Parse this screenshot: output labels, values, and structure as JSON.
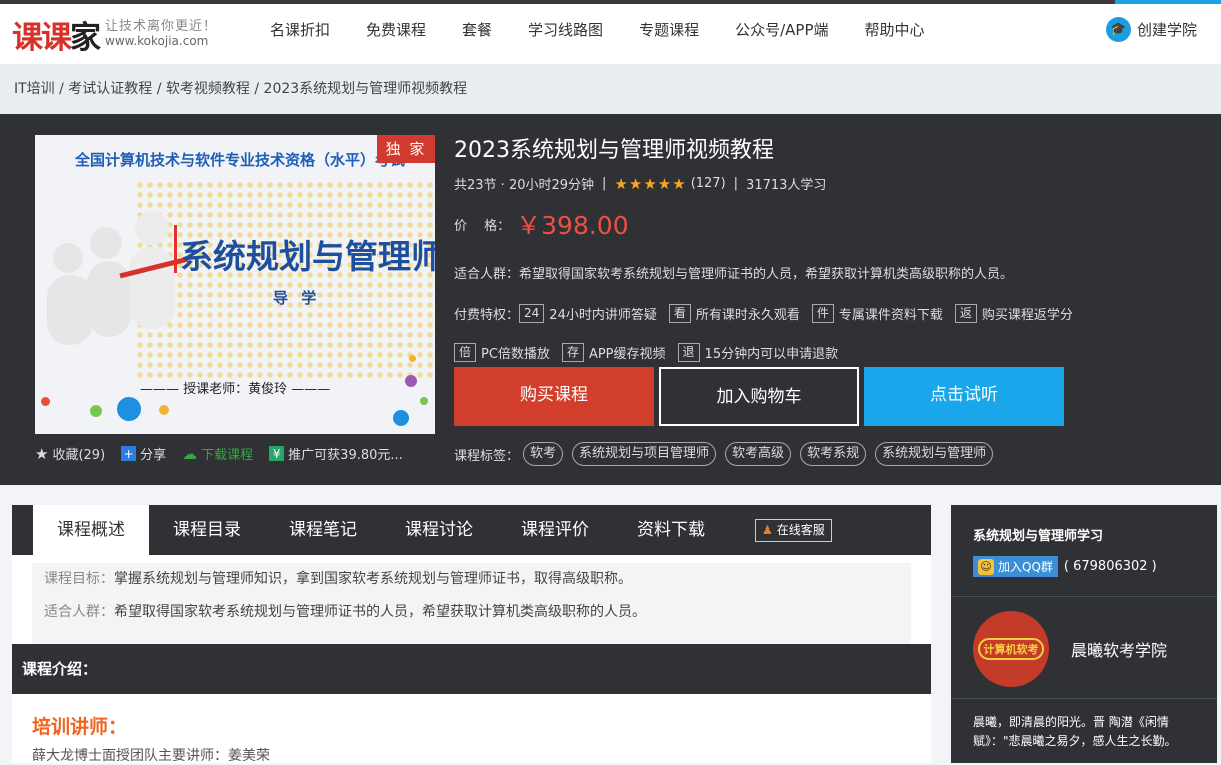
{
  "colors": {
    "brand_red": "#d8302a",
    "accent_blue": "#1aa3e8",
    "buy": "#d23e2c",
    "try": "#1aa6ea",
    "price": "#ef4f3f",
    "dark": "#2f3135",
    "lecturer": "#f0641e"
  },
  "logo": {
    "text_red": "课课",
    "text_black": "家",
    "slogan": "让技术离你更近！",
    "domain": "www.kokojia.com"
  },
  "nav": [
    "名课折扣",
    "免费课程",
    "套餐",
    "学习线路图",
    "专题课程",
    "公众号/APP端",
    "帮助中心"
  ],
  "create": {
    "label": "创建学院",
    "icon": "graduation-cap-icon"
  },
  "breadcrumb": "IT培训 / 考试认证教程 / 软考视频教程 / 2023系统规划与管理师视频教程",
  "cover": {
    "headline": "全国计算机技术与软件专业技术资格（水平）考试",
    "badge": "独 家",
    "title": "系统规划与管理师",
    "subtitle": "导 学",
    "teacher": "——— 授课老师：黄俊玲 ———"
  },
  "actions": {
    "favorite": "收藏(29)",
    "share": "分享",
    "download": "下载课程",
    "promo": "推广可获39.80元..."
  },
  "course": {
    "title": "2023系统规划与管理师视频教程",
    "lessons": "共23节 · 20小时29分钟",
    "rating": 5,
    "rating_count": "(127)",
    "learners": "31713人学习",
    "price_label": "价　 格：",
    "price": "￥398.00",
    "audience": "适合人群：希望取得国家软考系统规划与管理师证书的人员，希望获取计算机类高级职称的人员。",
    "privileges_label": "付费特权：",
    "privileges": [
      {
        "badge": "24",
        "text": "24小时内讲师答疑"
      },
      {
        "badge": "看",
        "text": "所有课时永久观看"
      },
      {
        "badge": "件",
        "text": "专属课件资料下载"
      },
      {
        "badge": "返",
        "text": "购买课程返学分"
      },
      {
        "badge": "倍",
        "text": "PC倍数播放"
      },
      {
        "badge": "存",
        "text": "APP缓存视频"
      },
      {
        "badge": "退",
        "text": "15分钟内可以申请退款"
      }
    ],
    "buttons": {
      "buy": "购买课程",
      "cart": "加入购物车",
      "try": "点击试听"
    },
    "tags_label": "课程标签：",
    "tags": [
      "软考",
      "系统规划与项目管理师",
      "软考高级",
      "软考系规",
      "系统规划与管理师"
    ]
  },
  "tabs": [
    "课程概述",
    "课程目录",
    "课程笔记",
    "课程讨论",
    "课程评价",
    "资料下载"
  ],
  "service_label": "在线客服",
  "goals": [
    {
      "label": "课程目标：",
      "text": "掌握系统规划与管理师知识，拿到国家软考系统规划与管理师证书，取得高级职称。"
    },
    {
      "label": "适合人群：",
      "text": "希望取得国家软考系统规划与管理师证书的人员，希望获取计算机类高级职称的人员。"
    }
  ],
  "intro_heading": "课程介绍：",
  "lecturer_heading": "培训讲师：",
  "lecturer_text": "薛大龙博士面授团队主要讲师：姜美荣",
  "sidebar": {
    "group_title": "系统规划与管理师学习",
    "qq_button": "加入QQ群",
    "qq_number": "( 679806302 )",
    "school_logo_text": "计算机软考",
    "school_name": "晨曦软考学院",
    "school_desc": "晨曦，即清晨的阳光。晋 陶潜《闲情赋》：\"悲晨曦之易夕，感人生之长勤。"
  }
}
